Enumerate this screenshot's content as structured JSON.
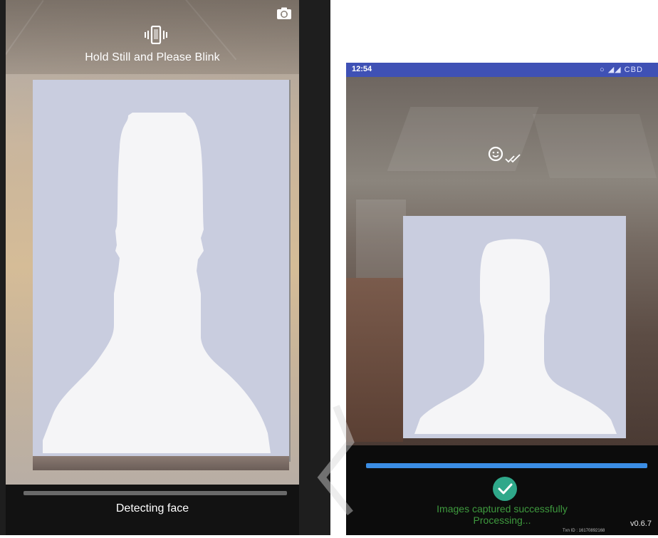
{
  "left_screen": {
    "instruction": "Hold Still and Please Blink",
    "status": "Detecting face",
    "icons": {
      "camera_switch": "camera-switch-icon",
      "vibrate": "vibrate-phone-icon"
    },
    "progress_color": "#6a6a6a"
  },
  "right_screen": {
    "status_bar": {
      "time": "12:54",
      "icons": "○ ◢◢ CBD",
      "color": "#3f51b5"
    },
    "success_line1": "Images captured successfully",
    "success_line2": "Processing...",
    "version": "v0.6.7",
    "txn_id": "Txn ID : 16170892168",
    "icons": {
      "face": "smiling-face-icon",
      "check": "check-circle-icon"
    },
    "progress_color": "#3b8de4",
    "success_color": "#3e9a3e"
  },
  "silhouette_color": "#c9cddf"
}
